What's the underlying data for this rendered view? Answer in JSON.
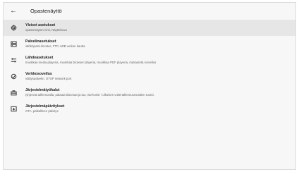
{
  "header": {
    "back_icon": "arrow-left-icon",
    "title": "Opastenäyttö"
  },
  "items": [
    {
      "icon": "gear-icon",
      "label": "Yleiset asetukset",
      "desc": "opastenäytön nimi, Näyttökuva",
      "selected": true
    },
    {
      "icon": "server-icon",
      "label": "Palvelinasetukset",
      "desc": "sähköposti-ilmoitus, FTP, ADB verkon kautta",
      "selected": false
    },
    {
      "icon": "sliders-icon",
      "label": "Lähdeasetukset",
      "desc": "muokkaa media playeria, muokkaa browser playeria, muokkaa PDF playeria, mukautettu sovellus",
      "selected": false
    },
    {
      "icon": "network-icon",
      "label": "Verkkosovellus",
      "desc": "välityspalvelin, OTSP network port",
      "selected": false
    },
    {
      "icon": "toolbox-icon",
      "label": "Järjestelmätyökalut",
      "desc": "tyhjennä tallennustila, palauta tilosmaa ja tuo, SD-kortin / ulkoisen USB-tallennusmuistien tuonti.",
      "selected": false
    },
    {
      "icon": "update-icon",
      "label": "Järjestelmäpäivitykset",
      "desc": "OTA, paikallinen päivitys",
      "selected": false
    }
  ]
}
